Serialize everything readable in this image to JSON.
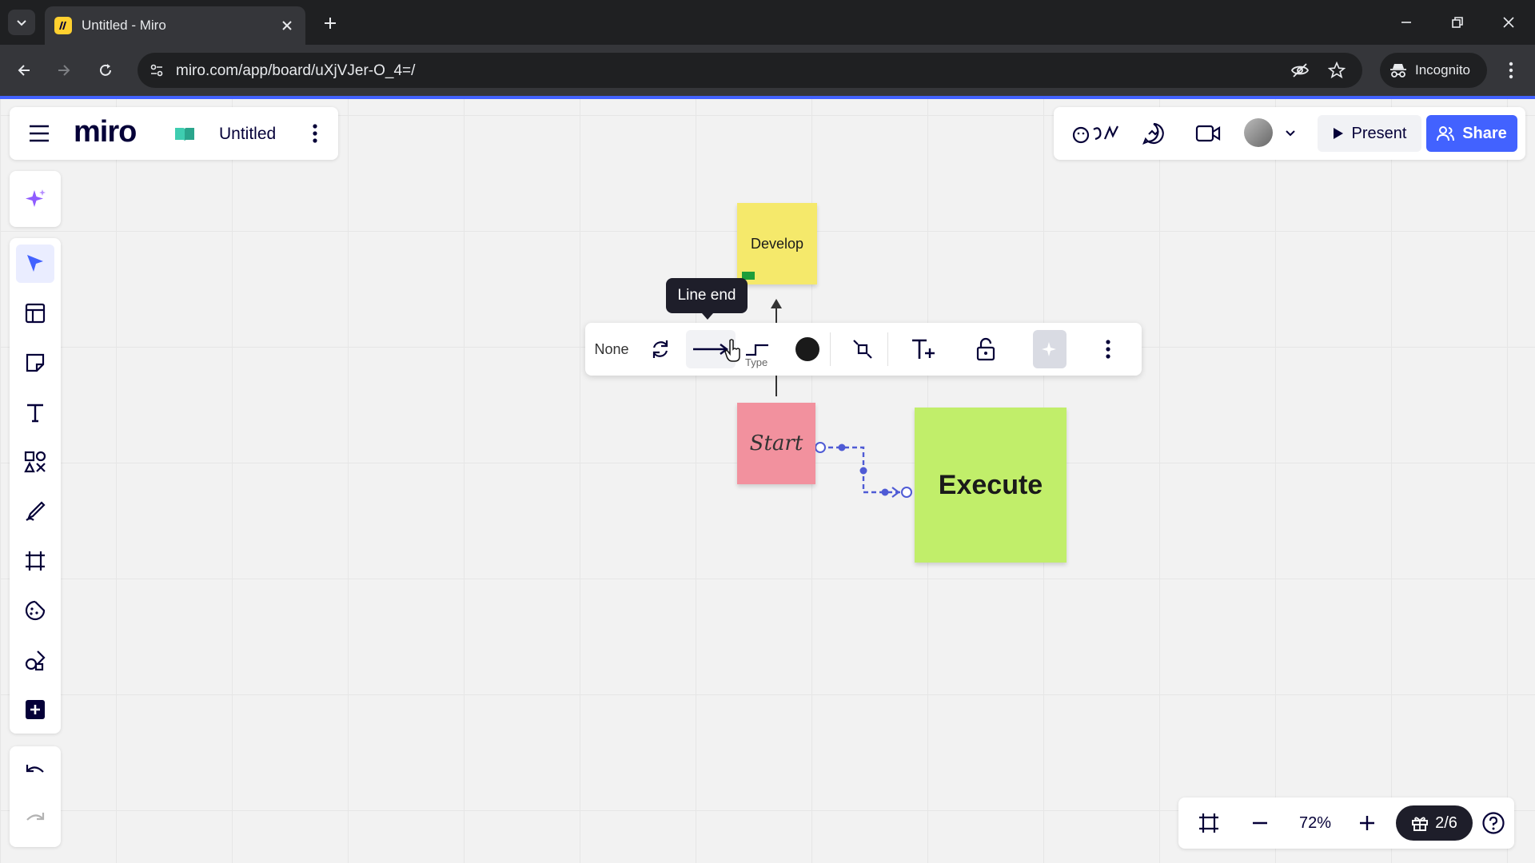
{
  "browser": {
    "tab_title": "Untitled - Miro",
    "url": "miro.com/app/board/uXjVJer-O_4=/",
    "incognito_label": "Incognito"
  },
  "board": {
    "logo": "miro",
    "name": "Untitled"
  },
  "header_actions": {
    "present_label": "Present",
    "share_label": "Share"
  },
  "stickies": {
    "develop": "Develop",
    "start": "Start",
    "execute": "Execute"
  },
  "tooltip": {
    "text": "Line end"
  },
  "context_toolbar": {
    "line_start": "None",
    "type_label": "Type"
  },
  "zoom": {
    "level": "72%",
    "pages": "2/6"
  },
  "colors": {
    "accent": "#4262ff",
    "develop_sticky": "#f5e96b",
    "start_sticky": "#f2919e",
    "execute_sticky": "#c1ee6a",
    "connector_selected": "#4f5bd5"
  },
  "icons": [
    "tab-list-icon",
    "miro-favicon",
    "close-tab-icon",
    "new-tab-icon",
    "minimize-icon",
    "restore-icon",
    "close-window-icon",
    "back-icon",
    "forward-icon",
    "reload-icon",
    "site-info-icon",
    "eye-off-icon",
    "star-icon",
    "incognito-icon",
    "menu-icon",
    "hamburger-icon",
    "board-icon",
    "more-vertical-icon",
    "reactions-icon",
    "chat-icon",
    "video-icon",
    "play-icon",
    "share-people-icon",
    "ai-sparkle-icon",
    "select-arrow-icon",
    "templates-icon",
    "sticky-note-icon",
    "text-icon",
    "shapes-icon",
    "pen-icon",
    "frame-icon",
    "stickers-icon",
    "apps-icon",
    "add-icon",
    "undo-icon",
    "redo-icon",
    "swap-icon",
    "arrow-end-icon",
    "elbow-line-icon",
    "color-dot-icon",
    "line-align-icon",
    "add-text-icon",
    "lock-icon",
    "ai-icon",
    "fit-screen-icon",
    "zoom-out-icon",
    "zoom-in-icon",
    "gift-icon",
    "help-icon"
  ]
}
